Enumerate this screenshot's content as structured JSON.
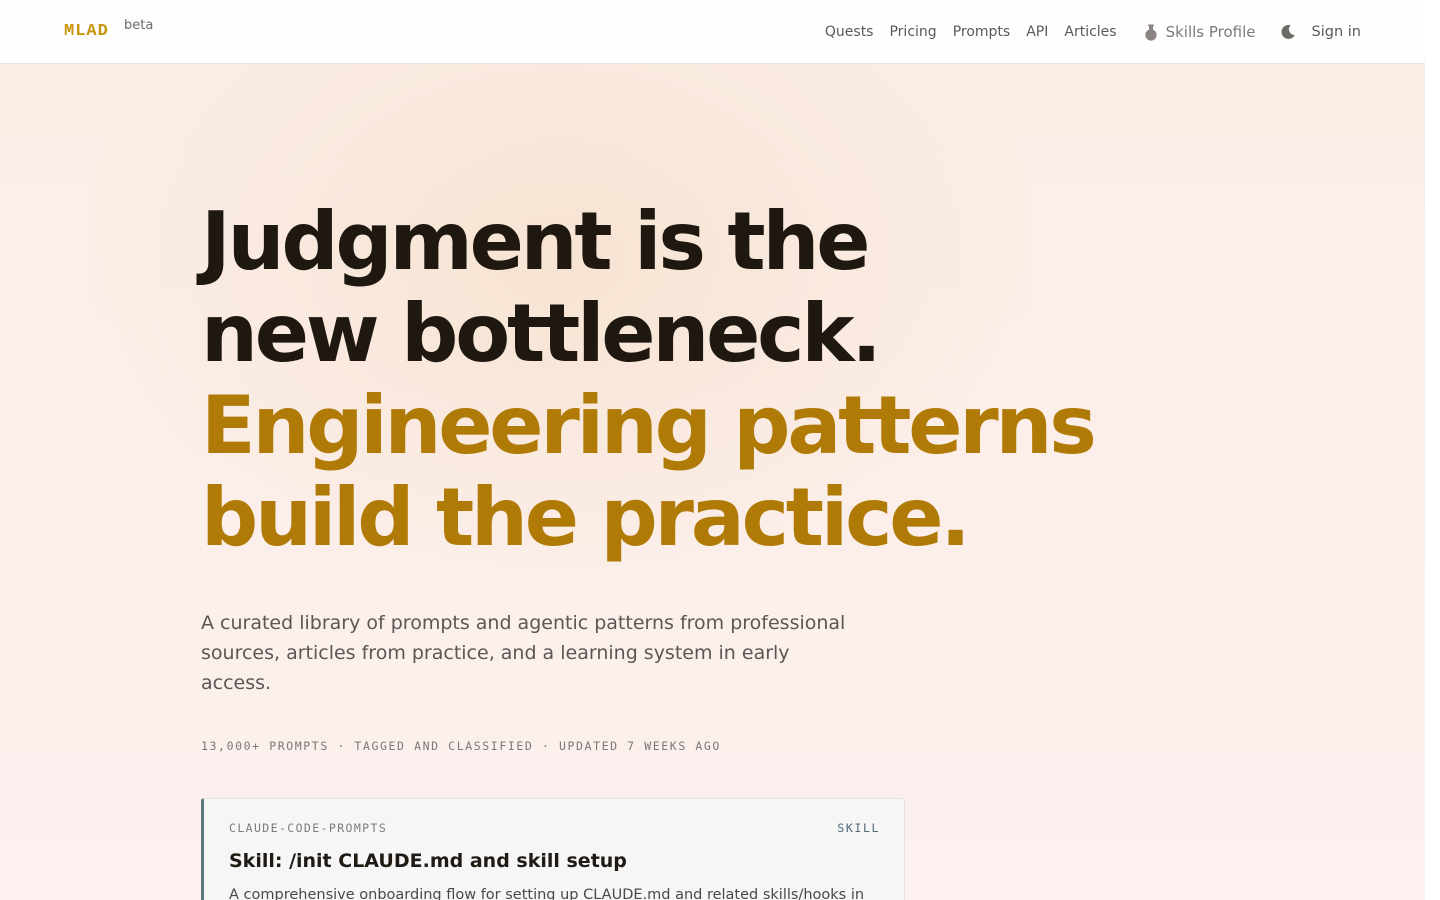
{
  "header": {
    "logo": "MLAD",
    "badge": "beta",
    "nav": {
      "quests": "Quests",
      "pricing": "Pricing",
      "prompts": "Prompts",
      "api": "API",
      "articles": "Articles",
      "skills_profile": "Skills Profile",
      "sign_in": "Sign in"
    },
    "icons": {
      "skills": "flask-icon",
      "theme": "moon-icon"
    }
  },
  "hero": {
    "title_line1": "Judgment is the",
    "title_line2": "new bottleneck.",
    "title_line3": "Engineering patterns",
    "title_line4": "build the practice.",
    "subtitle": "A curated library of prompts and agentic patterns from professional sources, articles from practice, and a learning system in early access.",
    "stats": "13,000+ PROMPTS · TAGGED AND CLASSIFIED · UPDATED 7 WEEKS AGO"
  },
  "featured_card": {
    "source": "CLAUDE-CODE-PROMPTS",
    "type": "SKILL",
    "title": "Skill: /init CLAUDE.md and skill setup",
    "description": "A comprehensive onboarding flow for setting up CLAUDE.md and related skills/hooks in"
  },
  "colors": {
    "accent": "#b07a06",
    "logo": "#c8950c",
    "heading": "#1e1810",
    "card_border": "#5f7580"
  }
}
